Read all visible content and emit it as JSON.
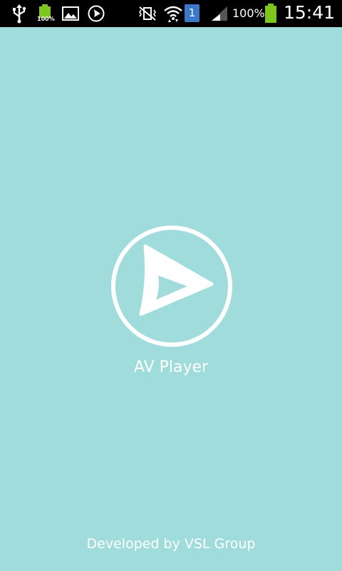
{
  "status_bar": {
    "left_icons": [
      "usb-icon",
      "battery-100-icon",
      "image-icon",
      "av-player-notification-icon"
    ],
    "battery_small_label": "100%",
    "right_icons": [
      "mute-icon",
      "wifi-icon",
      "sim-icon",
      "signal-icon",
      "battery-icon"
    ],
    "sim_number": "1",
    "battery_percent": "100%",
    "time": "15:41"
  },
  "splash": {
    "logo_icon": "play-logo-icon",
    "app_name": "AV Player",
    "footer": "Developed by VSL Group"
  },
  "colors": {
    "background": "#a0dcdc",
    "status_bar": "#000000",
    "battery_green": "#7ec51d",
    "sim_blue": "#3a78c9",
    "text": "#ffffff"
  }
}
